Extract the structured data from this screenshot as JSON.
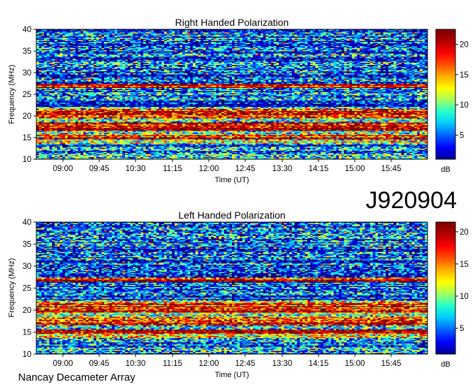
{
  "observation_id": "J920904",
  "instrument": "Nancay Decameter Array",
  "colors": {
    "colormap": [
      "#00008f",
      "#0000ff",
      "#0060ff",
      "#00c8ff",
      "#20ffd0",
      "#a0ff60",
      "#ffff00",
      "#ffb000",
      "#ff5000",
      "#ff0000",
      "#b00000",
      "#7f0000"
    ]
  },
  "chart_data": [
    {
      "type": "heatmap",
      "title": "Right Handed Polarization",
      "xlabel": "Time (UT)",
      "ylabel": "Frequency (MHz)",
      "x_tick_labels": [
        "09:00",
        "09:45",
        "10:30",
        "11:15",
        "12:00",
        "12:45",
        "13:30",
        "14:15",
        "15:00",
        "15:45"
      ],
      "y_ticks": [
        10,
        15,
        20,
        25,
        30,
        35,
        40
      ],
      "ylim": [
        10,
        40
      ],
      "colorbar": {
        "label": "dB",
        "ticks": [
          5,
          10,
          15,
          20
        ],
        "range": [
          1,
          22.5
        ]
      },
      "bright_bands_mhz": [
        [
          14.5,
          15.5
        ],
        [
          16.5,
          18.5
        ],
        [
          19.5,
          21.5
        ],
        [
          26.5,
          27.5
        ]
      ]
    },
    {
      "type": "heatmap",
      "title": "Left Handed Polarization",
      "xlabel": "Time (UT)",
      "ylabel": "Frequency (MHz)",
      "x_tick_labels": [
        "09:00",
        "09:45",
        "10:30",
        "11:15",
        "12:00",
        "12:45",
        "13:30",
        "14:15",
        "15:00",
        "15:45"
      ],
      "y_ticks": [
        10,
        15,
        20,
        25,
        30,
        35,
        40
      ],
      "ylim": [
        10,
        40
      ],
      "colorbar": {
        "label": "dB",
        "ticks": [
          5,
          10,
          15,
          20
        ],
        "range": [
          1,
          21.5
        ]
      },
      "bright_bands_mhz": [
        [
          14.5,
          15.5
        ],
        [
          16.5,
          18.5
        ],
        [
          19.5,
          21.5
        ],
        [
          26.5,
          27.5
        ]
      ]
    }
  ]
}
